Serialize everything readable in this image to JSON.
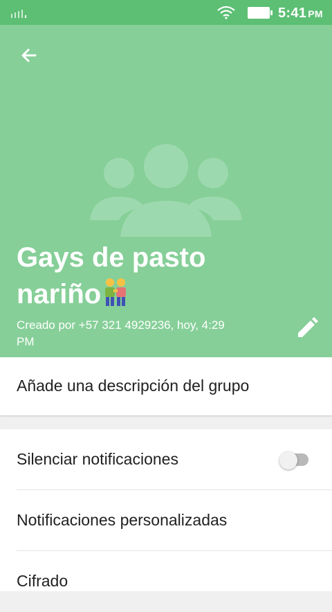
{
  "status_bar": {
    "time": "5:41",
    "ampm": "PM",
    "icons": [
      "signal-icon",
      "wifi-icon",
      "battery-icon"
    ]
  },
  "header": {
    "title_line1": "Gays de pasto",
    "title_line2": "nariño",
    "emoji": "👬",
    "subtitle_line1": "Creado por +57 321 4929236, hoy, 4:29",
    "subtitle_line2": "PM",
    "back_icon": "arrow-left-icon",
    "edit_icon": "pencil-icon",
    "group_icon": "group-icon"
  },
  "description": {
    "label": "Añade una descripción del grupo"
  },
  "settings": {
    "rows": [
      {
        "label": "Silenciar notificaciones",
        "control": "toggle",
        "enabled": false
      },
      {
        "label": "Notificaciones personalizadas"
      },
      {
        "label": "Cifrado"
      }
    ]
  },
  "colors": {
    "status_bar": "#5cbf74",
    "header": "#86cf98",
    "text": "#212121"
  }
}
